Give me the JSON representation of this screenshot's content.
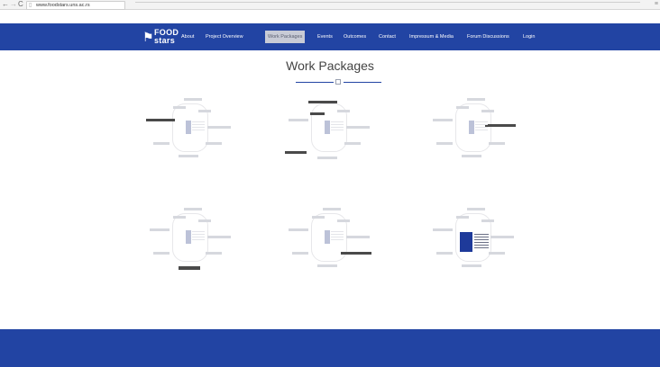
{
  "browser": {
    "back": "←",
    "forward": "→",
    "reload": "C",
    "url": "www.foodstars.uns.ac.rs",
    "menu": "≡"
  },
  "header": {
    "logo_line1": "FOOD",
    "logo_line2": "stars",
    "nav": [
      {
        "label": "About"
      },
      {
        "label": "Project Overview"
      },
      {
        "label": "Work Packages",
        "active": true
      },
      {
        "label": "Events"
      },
      {
        "label": "Outcomes"
      },
      {
        "label": "Contact"
      },
      {
        "label": "Impressum & Media"
      },
      {
        "label": "Forum Discussions"
      },
      {
        "label": "Login"
      }
    ]
  },
  "main": {
    "title": "Work Packages"
  },
  "colors": {
    "brand_blue": "#2244a3",
    "nav_active_bg": "#c8cbd6",
    "background": "#ffffff"
  }
}
